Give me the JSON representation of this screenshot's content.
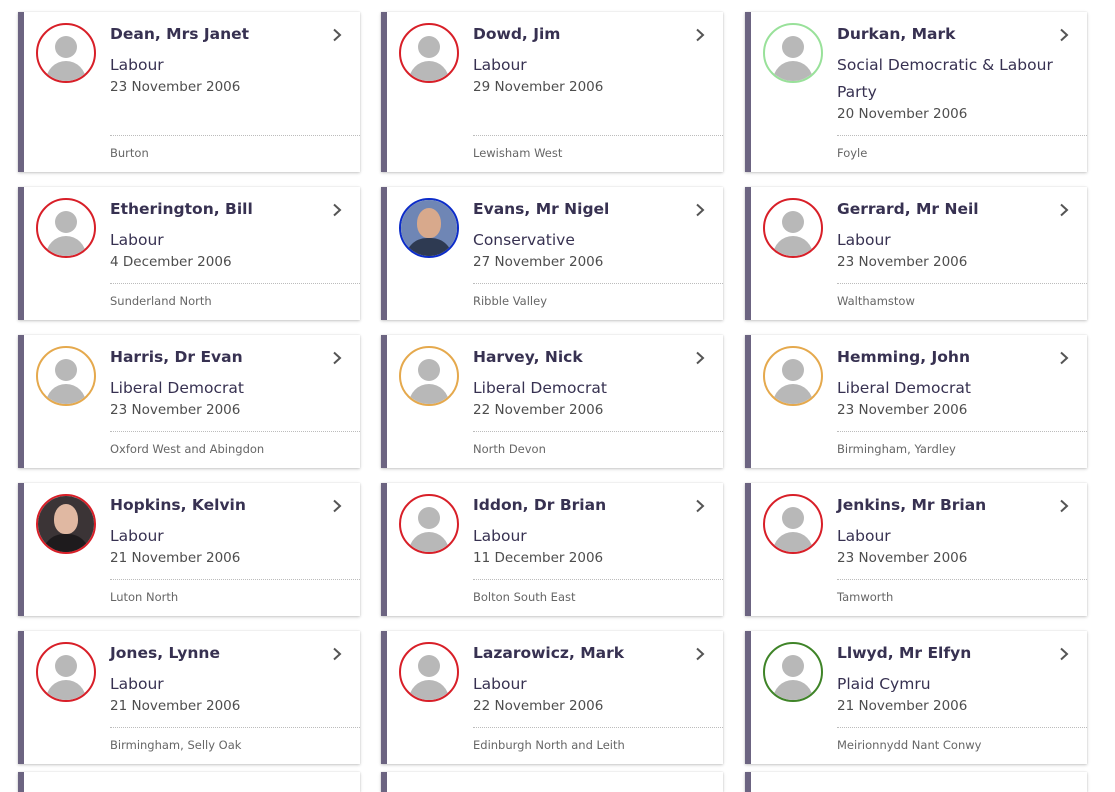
{
  "members": [
    {
      "name": "Dean, Mrs Janet",
      "party": "Labour",
      "date": "23 November 2006",
      "constituency": "Burton",
      "party_color": "#d81f28",
      "photo": null
    },
    {
      "name": "Dowd, Jim",
      "party": "Labour",
      "date": "29 November 2006",
      "constituency": "Lewisham West",
      "party_color": "#d81f28",
      "photo": null
    },
    {
      "name": "Durkan, Mark",
      "party": "Social Democratic & Labour Party",
      "date": "20 November 2006",
      "constituency": "Foyle",
      "party_color": "#99e19a",
      "photo": null
    },
    {
      "name": "Etherington, Bill",
      "party": "Labour",
      "date": "4 December 2006",
      "constituency": "Sunderland North",
      "party_color": "#d81f28",
      "photo": null
    },
    {
      "name": "Evans, Mr Nigel",
      "party": "Conservative",
      "date": "27 November 2006",
      "constituency": "Ribble Valley",
      "party_color": "#0c2cc9",
      "photo": "blue"
    },
    {
      "name": "Gerrard, Mr Neil",
      "party": "Labour",
      "date": "23 November 2006",
      "constituency": "Walthamstow",
      "party_color": "#d81f28",
      "photo": null
    },
    {
      "name": "Harris, Dr Evan",
      "party": "Liberal Democrat",
      "date": "23 November 2006",
      "constituency": "Oxford West and Abingdon",
      "party_color": "#e5a94d",
      "photo": null
    },
    {
      "name": "Harvey, Nick",
      "party": "Liberal Democrat",
      "date": "22 November 2006",
      "constituency": "North Devon",
      "party_color": "#e5a94d",
      "photo": null
    },
    {
      "name": "Hemming, John",
      "party": "Liberal Democrat",
      "date": "23 November 2006",
      "constituency": "Birmingham, Yardley",
      "party_color": "#e5a94d",
      "photo": null
    },
    {
      "name": "Hopkins, Kelvin",
      "party": "Labour",
      "date": "21 November 2006",
      "constituency": "Luton North",
      "party_color": "#d81f28",
      "photo": "dark"
    },
    {
      "name": "Iddon, Dr Brian",
      "party": "Labour",
      "date": "11 December 2006",
      "constituency": "Bolton South East",
      "party_color": "#d81f28",
      "photo": null
    },
    {
      "name": "Jenkins, Mr Brian",
      "party": "Labour",
      "date": "23 November 2006",
      "constituency": "Tamworth",
      "party_color": "#d81f28",
      "photo": null
    },
    {
      "name": "Jones, Lynne",
      "party": "Labour",
      "date": "21 November 2006",
      "constituency": "Birmingham, Selly Oak",
      "party_color": "#d81f28",
      "photo": null
    },
    {
      "name": "Lazarowicz, Mark",
      "party": "Labour",
      "date": "22 November 2006",
      "constituency": "Edinburgh North and Leith",
      "party_color": "#d81f28",
      "photo": null
    },
    {
      "name": "Llwyd, Mr Elfyn",
      "party": "Plaid Cymru",
      "date": "21 November 2006",
      "constituency": "Meirionnydd Nant Conwy",
      "party_color": "#3f8428",
      "photo": null
    }
  ],
  "icons": {
    "chevron": "chevron-right-icon",
    "avatar": "person-placeholder-icon"
  }
}
